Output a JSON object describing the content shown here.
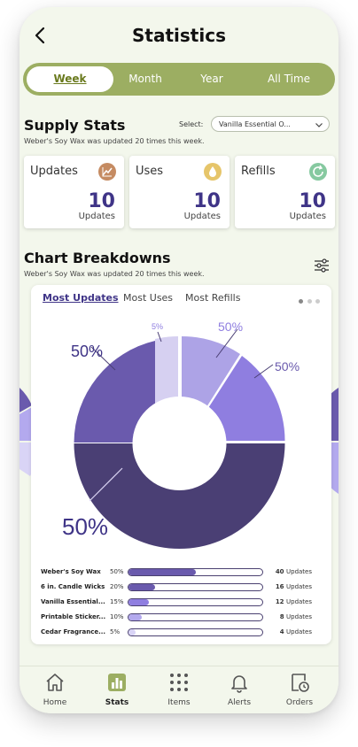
{
  "header": {
    "title": "Statistics"
  },
  "period_tabs": [
    {
      "label": "Week",
      "active": true
    },
    {
      "label": "Month",
      "active": false
    },
    {
      "label": "Year",
      "active": false
    },
    {
      "label": "All Time",
      "active": false
    }
  ],
  "supply_stats": {
    "title": "Supply Stats",
    "select_label": "Select:",
    "select_value": "Vanilla Essential O...",
    "subtitle": "Weber's Soy Wax was updated 20 times this week.",
    "cards": [
      {
        "label": "Updates",
        "value": "10",
        "unit": "Updates",
        "icon": "chart-icon",
        "color": "#c58b62"
      },
      {
        "label": "Uses",
        "value": "10",
        "unit": "Updates",
        "icon": "drop-icon",
        "color": "#e6c56a"
      },
      {
        "label": "Refills",
        "value": "10",
        "unit": "Updates",
        "icon": "refresh-icon",
        "color": "#86c9a0"
      }
    ]
  },
  "chart_breakdowns": {
    "title": "Chart Breakdowns",
    "subtitle": "Weber's Soy Wax was updated 20 times this week.",
    "tabs": [
      {
        "label": "Most Updates",
        "active": true
      },
      {
        "label": "Most Uses",
        "active": false
      },
      {
        "label": "Most Refills",
        "active": false
      }
    ]
  },
  "chart_data": {
    "type": "pie",
    "slice_labels": [
      "50%",
      "50%",
      "50%",
      "5%",
      "50%"
    ],
    "slice_colors": [
      "#4a3f74",
      "#6a5aad",
      "#d6d0f1",
      "#ada3e6",
      "#8f7ee0"
    ],
    "items": [
      {
        "name": "Weber's Soy Wax",
        "percent": 50,
        "percent_label": "50%",
        "count": "40",
        "unit": "Updates",
        "color": "#6a5aad"
      },
      {
        "name": "6 in. Candle Wicks",
        "percent": 20,
        "percent_label": "20%",
        "count": "16",
        "unit": "Updates",
        "color": "#6a5aad"
      },
      {
        "name": "Vanilla Essential...",
        "percent": 15,
        "percent_label": "15%",
        "count": "12",
        "unit": "Updates",
        "color": "#8f7ee0"
      },
      {
        "name": "Printable Sticker...",
        "percent": 10,
        "percent_label": "10%",
        "count": "8",
        "unit": "Updates",
        "color": "#b3a9ee"
      },
      {
        "name": "Cedar Fragrance...",
        "percent": 5,
        "percent_label": "5%",
        "count": "4",
        "unit": "Updates",
        "color": "#d9d4f6"
      }
    ]
  },
  "nav": [
    {
      "label": "Home",
      "icon": "home-icon",
      "active": false
    },
    {
      "label": "Stats",
      "icon": "stats-icon",
      "active": true
    },
    {
      "label": "Items",
      "icon": "items-icon",
      "active": false
    },
    {
      "label": "Alerts",
      "icon": "bell-icon",
      "active": false
    },
    {
      "label": "Orders",
      "icon": "orders-icon",
      "active": false
    }
  ]
}
